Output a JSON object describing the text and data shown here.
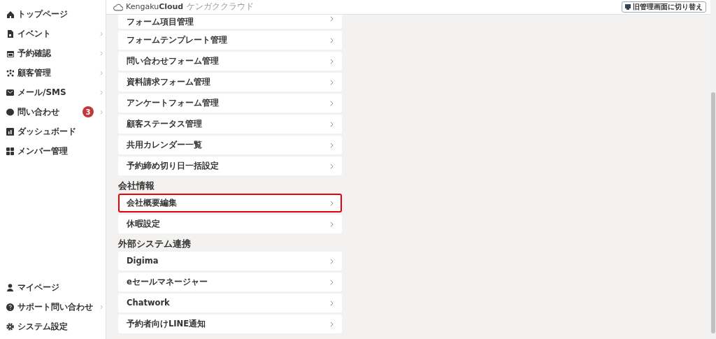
{
  "sidebar": {
    "items": [
      {
        "label": "トップページ",
        "expandable": false
      },
      {
        "label": "イベント",
        "expandable": true
      },
      {
        "label": "予約確認",
        "expandable": true
      },
      {
        "label": "顧客管理",
        "expandable": true
      },
      {
        "label": "メール/SMS",
        "expandable": true
      },
      {
        "label": "問い合わせ",
        "expandable": true,
        "badge": "3"
      },
      {
        "label": "ダッシュボード",
        "expandable": false
      },
      {
        "label": "メンバー管理",
        "expandable": false
      }
    ],
    "bottom_items": [
      {
        "label": "マイページ",
        "expandable": false
      },
      {
        "label": "サポート問い合わせ",
        "expandable": true
      },
      {
        "label": "システム設定",
        "expandable": false
      }
    ]
  },
  "header": {
    "logo": "Kengaku**Cloud**",
    "logo_sub": "ケンガククラウド",
    "switch_button": "旧管理画面に切り替え"
  },
  "sections": [
    {
      "items": [
        {
          "label": "フォーム項目管理",
          "highlighted": false
        },
        {
          "label": "フォームテンプレート管理",
          "highlighted": false
        },
        {
          "label": "問い合わせフォーム管理",
          "highlighted": false
        },
        {
          "label": "資料請求フォーム管理",
          "highlighted": false
        },
        {
          "label": "アンケートフォーム管理",
          "highlighted": false
        },
        {
          "label": "顧客ステータス管理",
          "highlighted": false
        },
        {
          "label": "共用カレンダー一覧",
          "highlighted": false
        },
        {
          "label": "予約締め切り日一括設定",
          "highlighted": false
        }
      ]
    },
    {
      "title": "会社情報",
      "items": [
        {
          "label": "会社概要編集",
          "highlighted": true
        },
        {
          "label": "休暇設定",
          "highlighted": false
        }
      ]
    },
    {
      "title": "外部システム連携",
      "items": [
        {
          "label": "Digima",
          "highlighted": false
        },
        {
          "label": "eセールマネージャー",
          "highlighted": false
        },
        {
          "label": "Chatwork",
          "highlighted": false
        },
        {
          "label": "予約者向けLINE通知",
          "highlighted": false
        }
      ]
    }
  ]
}
